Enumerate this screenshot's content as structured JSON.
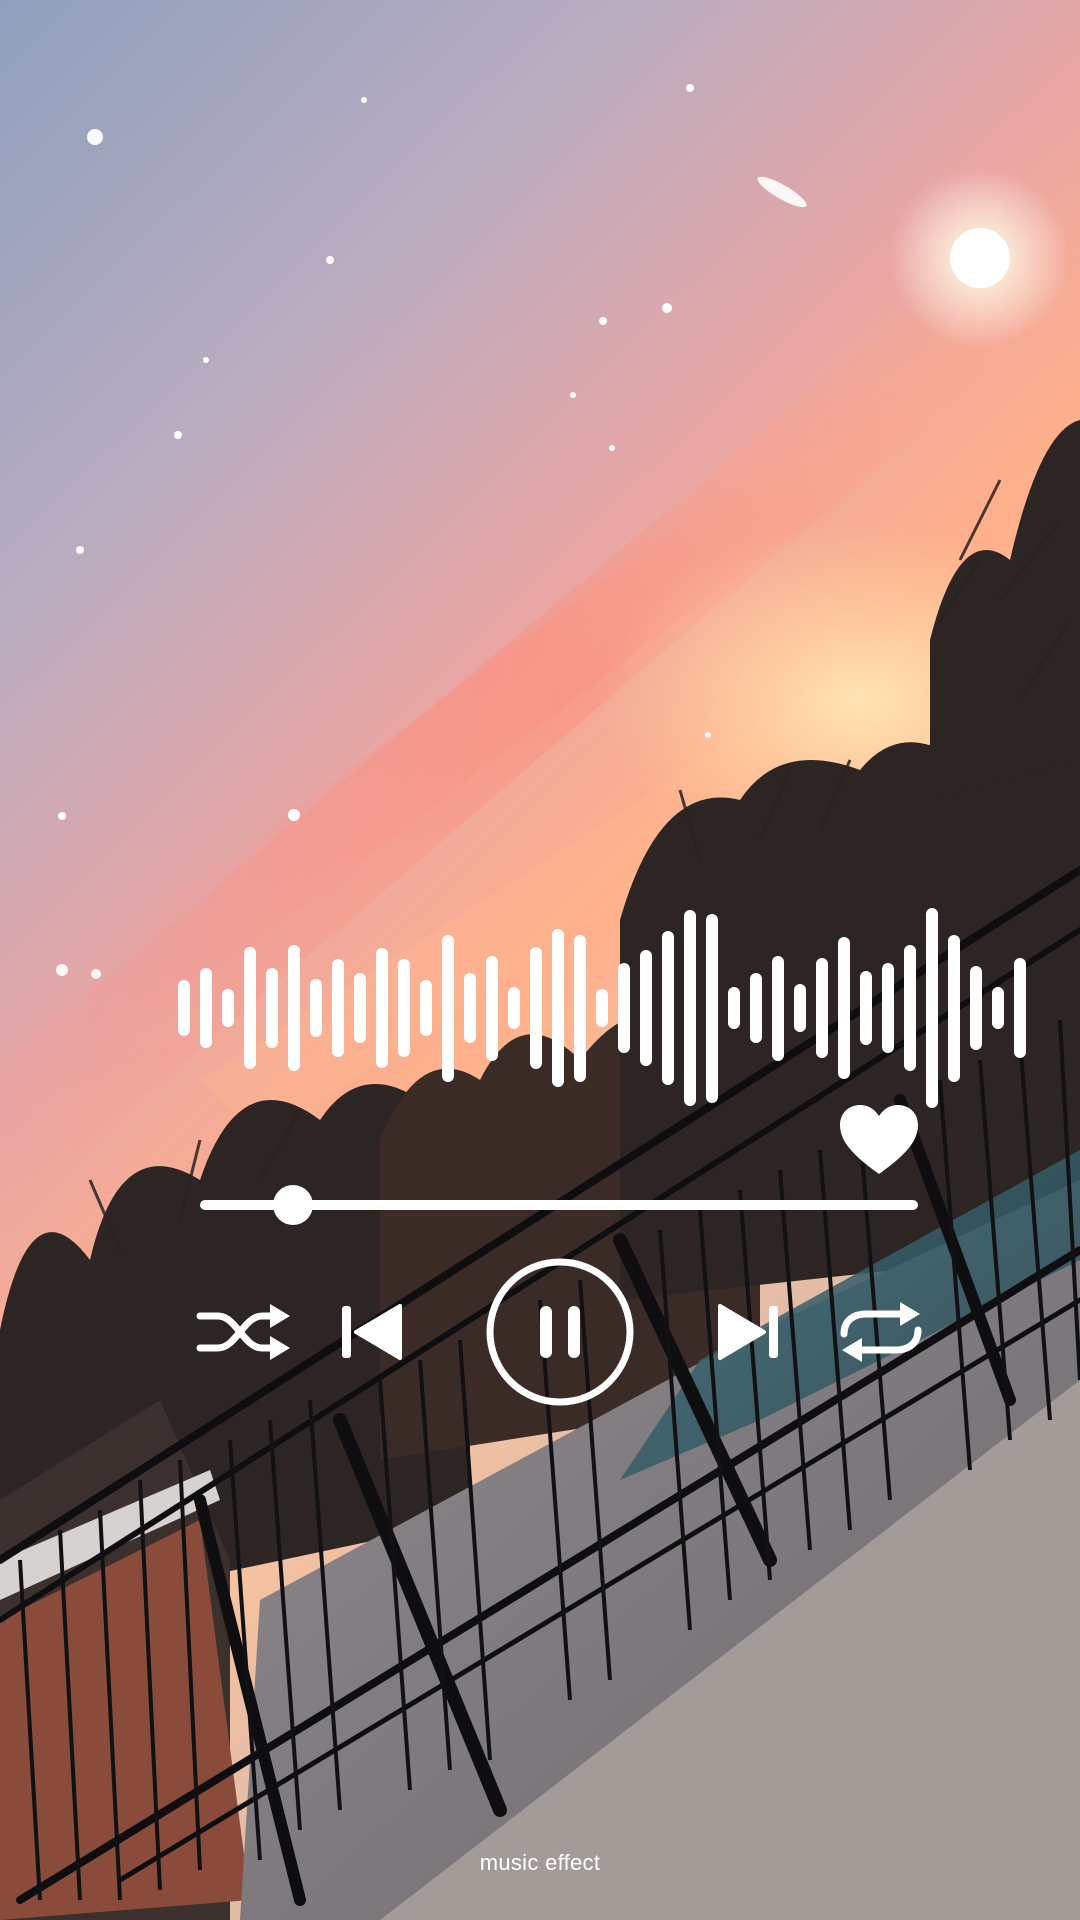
{
  "player": {
    "caption": "music effect",
    "liked": true,
    "progress": 0.13,
    "is_playing": true,
    "waveform_levels": [
      0.27,
      0.38,
      0.18,
      0.58,
      0.38,
      0.6,
      0.28,
      0.47,
      0.33,
      0.57,
      0.47,
      0.27,
      0.7,
      0.33,
      0.5,
      0.2,
      0.58,
      0.75,
      0.7,
      0.18,
      0.43,
      0.55,
      0.73,
      0.93,
      0.9,
      0.2,
      0.33,
      0.5,
      0.23,
      0.48,
      0.68,
      0.35,
      0.43,
      0.6,
      0.95,
      0.7,
      0.4,
      0.2,
      0.48
    ],
    "controls": {
      "shuffle_icon": "shuffle-icon",
      "previous_icon": "skip-previous-icon",
      "play_pause_icon": "pause-icon",
      "next_icon": "skip-next-icon",
      "repeat_icon": "repeat-icon",
      "like_icon": "heart-icon"
    },
    "colors": {
      "controls": "#ffffff",
      "sky_top": "#8ea0bc",
      "sky_glow": "#ff9a86",
      "horizon": "#ffd9a8"
    }
  }
}
